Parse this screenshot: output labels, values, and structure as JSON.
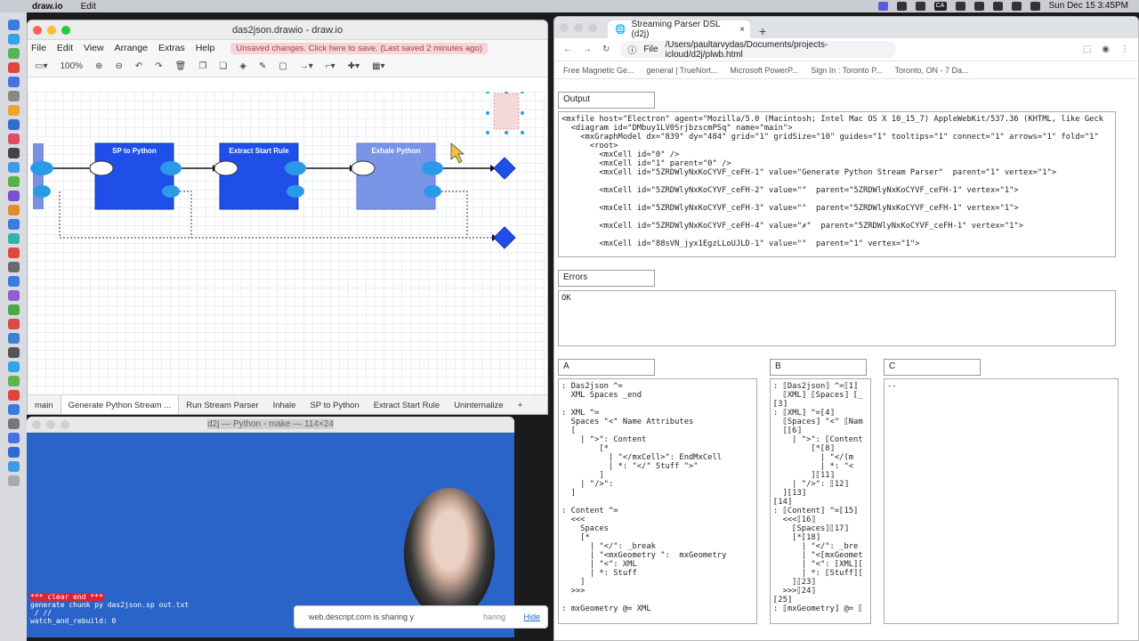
{
  "menubar": {
    "app": "draw.io",
    "edit": "Edit",
    "clock": "Sun Dec 15  3:45PM",
    "ca": "CA"
  },
  "drawio": {
    "title": "das2json.drawio - draw.io",
    "menu": [
      "File",
      "Edit",
      "View",
      "Arrange",
      "Extras",
      "Help"
    ],
    "unsaved": "Unsaved changes. Click here to save. (Last saved 2 minutes ago)",
    "zoom": "100%",
    "nodes": [
      {
        "label": "SP to Python"
      },
      {
        "label": "Extract Start Rule"
      },
      {
        "label": "Exhale Python"
      }
    ],
    "tabs": [
      "main",
      "Generate Python Stream ...",
      "Run Stream Parser",
      "Inhale",
      "SP to Python",
      "Extract Start Rule",
      "Uninternalize"
    ]
  },
  "terminal": {
    "title": "d2j — Python - make — 114×24",
    "line1": "*** clear end ***",
    "line2": "generate chunk py das2json.sp out.txt",
    "line3": " / //",
    "line4": "watch_and_rebuild: 0"
  },
  "browser": {
    "tab": "Streaming Parser DSL (d2j)",
    "file": "File",
    "url": "/Users/paultarvydas/Documents/projects-icloud/d2j/plwb.html",
    "bookmarks": [
      "Free Magnetic Ge...",
      "general | TrueNort...",
      "Microsoft PowerP...",
      "Sign In : Toronto P...",
      "Toronto, ON - 7 Da..."
    ],
    "output_label": "Output",
    "output": "<mxfile host=\"Electron\" agent=\"Mozilla/5.0 (Macintosh; Intel Mac OS X 10_15_7) AppleWebKit/537.36 (KHTML, like Geck\n  <diagram id=\"DMbuy1LV0SrjbzscmPSq\" name=\"main\">\n    <mxGraphModel dx=\"839\" dy=\"484\" grid=\"1\" gridSize=\"10\" guides=\"1\" tooltips=\"1\" connect=\"1\" arrows=\"1\" fold=\"1\"\n      <root>\n        <mxCell id=\"0\" />\n        <mxCell id=\"1\" parent=\"0\" />\n        <mxCell id=\"5ZRDWlyNxKoCYVF_ceFH-1\" value=\"Generate Python Stream Parser\"  parent=\"1\" vertex=\"1\">\n\n        <mxCell id=\"5ZRDWlyNxKoCYVF_ceFH-2\" value=\"\"  parent=\"5ZRDWlyNxKoCYVF_ceFH-1\" vertex=\"1\">\n\n        <mxCell id=\"5ZRDWlyNxKoCYVF_ceFH-3\" value=\"\"  parent=\"5ZRDWlyNxKoCYVF_ceFH-1\" vertex=\"1\">\n\n        <mxCell id=\"5ZRDWlyNxKoCYVF_ceFH-4\" value=\"✗\"  parent=\"5ZRDWlyNxKoCYVF_ceFH-1\" vertex=\"1\">\n\n        <mxCell id=\"88sVN_jyx1EgzLLoUJLD-1\" value=\"\"  parent=\"1\" vertex=\"1\">",
    "errors_label": "Errors",
    "errors": "OK",
    "a_label": "A",
    "a_text": ": Das2json ^=\n  XML Spaces _end\n\n: XML ^=\n  Spaces \"<\" Name Attributes\n  [\n    | \">\": Content\n        [*\n          | \"</mxCell>\": EndMxCell\n          | *: \"</\" Stuff \">\"\n        ]\n    | \"/>\":\n  ]\n\n: Content ^=\n  <<<\n    Spaces\n    [*\n      | \"</\": _break\n      | \"<mxGeometry \":  mxGeometry\n      | \"<\": XML\n      | *: Stuff\n    ]\n  >>>\n\n: mxGeometry @= XML",
    "b_label": "B",
    "b_text": ": ⟦Das2json⟧ ^=⟦1⟧\n  ⟦XML⟧ ⟦Spaces⟧ ⟦_\n⟦3⟧\n: ⟦XML⟧ ^=⟦4⟧\n  ⟦Spaces⟧ \"<\" ⟦Nam\n  [⟦6⟧\n    | \">\": ⟦Content\n        [*⟦8⟧\n          | \"</(m\n          | *: \"<\n        ]⟦11⟧\n    | \"/>\": ⟦12⟧\n  ]⟦13⟧\n⟦14⟧\n: ⟦Content⟧ ^=⟦15⟧\n  <<<⟦16⟧\n    ⟦Spaces⟧⟦17⟧\n    [*⟦18⟧\n      | \"</\": _bre\n      | \"<⟦mxGeomet\n      | \"<\": ⟦XML⟧[\n      | *: ⟦Stuff⟧[\n    ]⟦23⟧\n  >>>⟦24⟧\n⟦25⟧\n: ⟦mxGeometry⟧ @= ⟦",
    "c_label": "C",
    "c_text": "--"
  },
  "share": {
    "text": "web.descript.com is sharing y",
    "sharing": "haring",
    "hide": "Hide"
  }
}
